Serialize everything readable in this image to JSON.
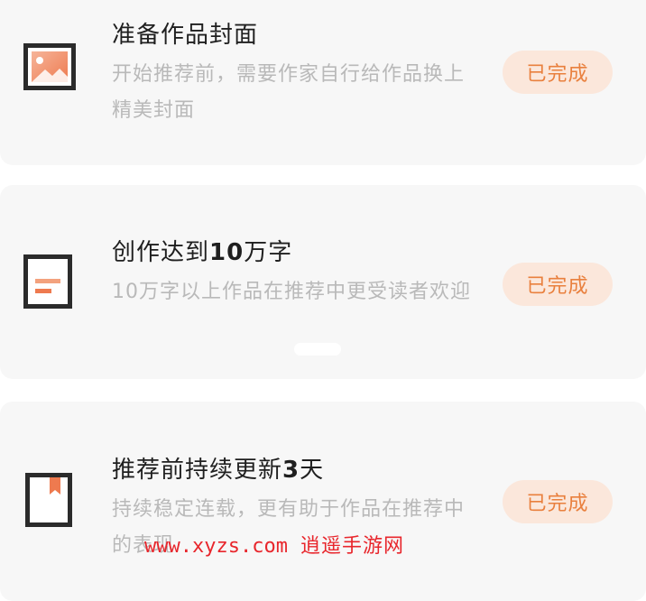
{
  "tasks": [
    {
      "title": "准备作品封面",
      "description": "开始推荐前，需要作家自行给作品换上精美封面",
      "status": "已完成",
      "icon": "image-icon"
    },
    {
      "title_prefix": "创作达到",
      "title_bold": "10",
      "title_suffix": "万字",
      "description": "10万字以上作品在推荐中更受读者欢迎",
      "status": "已完成",
      "icon": "document-icon"
    },
    {
      "title_prefix": "推荐前持续更新",
      "title_bold": "3",
      "title_suffix": "天",
      "description": "持续稳定连载，更有助于作品在推荐中的表现",
      "status": "已完成",
      "icon": "bookmark-icon"
    }
  ],
  "watermark": {
    "url": "www.xyzs.com",
    "name": "逍遥手游网"
  },
  "colors": {
    "accent": "#e9803e",
    "accent_bg": "#fbe7db",
    "watermark": "#e8262c"
  }
}
